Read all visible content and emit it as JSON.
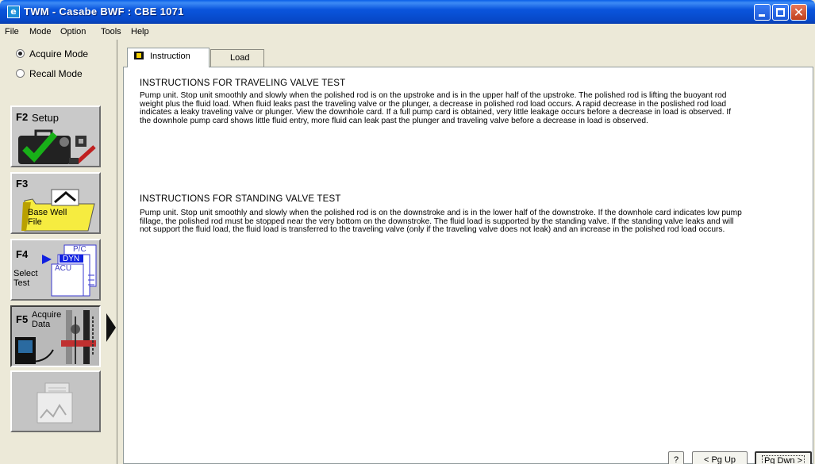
{
  "window": {
    "title": "TWM  -  Casabe BWF : CBE 1071",
    "icon": "app-icon"
  },
  "menu": [
    "File",
    "Mode",
    "Option",
    "Tools",
    "Help"
  ],
  "sidebar": {
    "modes": [
      {
        "label": "Acquire Mode",
        "selected": true
      },
      {
        "label": "Recall Mode",
        "selected": false
      }
    ],
    "function_keys": [
      {
        "key": "F2",
        "label": "Setup"
      },
      {
        "key": "F3",
        "label": "Base Well File"
      },
      {
        "key": "F4",
        "label": "Select Test",
        "doc_labels": [
          "P/C",
          "DYN",
          "ACU"
        ]
      },
      {
        "key": "F5",
        "label": "Acquire Data"
      },
      {
        "key": "",
        "label": ""
      }
    ]
  },
  "tabs": [
    {
      "label": "Instruction",
      "selected": true
    },
    {
      "label": "Load",
      "selected": false
    }
  ],
  "instructions": {
    "traveling": {
      "title": "INSTRUCTIONS FOR TRAVELING VALVE TEST",
      "body": "Pump unit.  Stop unit smoothly and slowly when the polished rod is on the upstroke and is in the upper half of the upstroke.  The polished rod is lifting the buoyant rod weight plus the fluid load.  When fluid leaks past the traveling valve or the plunger, a decrease in polished rod load occurs.  A rapid decrease in the poslished rod load indicates a leaky traveling valve or plunger.  View the downhole card.  If a full pump card is obtained, very little leakage occurs before a decrease in load is observed.  If the downhole pump card shows little fluid entry, more fluid can leak past the plunger and traveling valve before a decrease in load is observed."
    },
    "standing": {
      "title": "INSTRUCTIONS FOR STANDING VALVE TEST",
      "body": "Pump unit.  Stop unit smoothly and slowly when the polished rod is on the downstroke and is in the lower half of the downstroke.  If the downhole card indicates low pump fillage, the polished rod must be stopped near the very bottom on the downstroke.  The fluid load is supported by the standing valve.  If the standing valve leaks and will not support the fluid load, the fluid load is transferred to the traveling valve (only if the traveling valve does not leak) and an increase in the polished rod load occurs."
    }
  },
  "buttons": {
    "help": "?",
    "pg_up": "< Pg Up",
    "pg_down": "Pg Dwn >"
  }
}
